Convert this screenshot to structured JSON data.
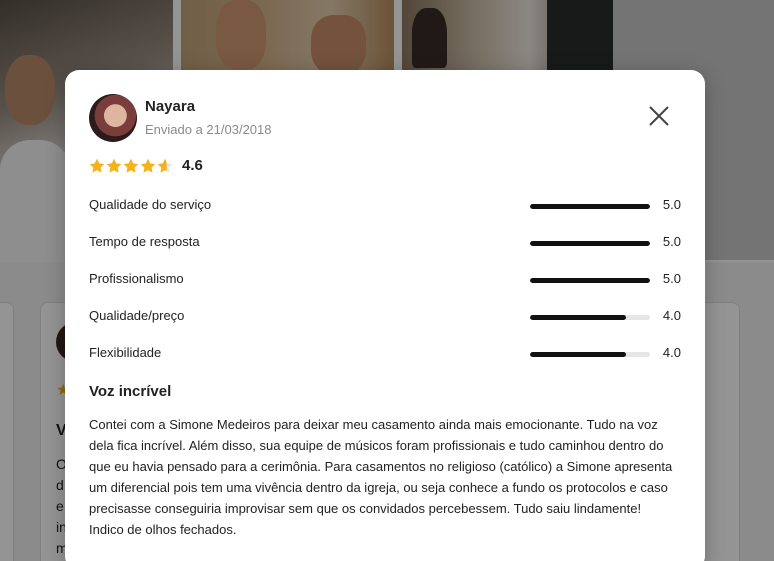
{
  "review": {
    "author": "Nayara",
    "date": "Enviado a 21/03/2018",
    "rating": 4.6,
    "rating_text": "4.6",
    "stars_filled": 4.6,
    "criteria": [
      {
        "label": "Qualidade do serviço",
        "value": "5.0",
        "score": 5.0
      },
      {
        "label": "Tempo de resposta",
        "value": "5.0",
        "score": 5.0
      },
      {
        "label": "Profissionalismo",
        "value": "5.0",
        "score": 5.0
      },
      {
        "label": "Qualidade/preço",
        "value": "4.0",
        "score": 4.0
      },
      {
        "label": "Flexibilidade",
        "value": "4.0",
        "score": 4.0
      }
    ],
    "title": "Voz incrível",
    "body": "Contei com a Simone Medeiros para deixar meu casamento ainda mais emocionante. Tudo na voz dela fica incrível. Além disso, sua equipe de músicos foram profissionais e tudo caminhou dentro do que eu havia pensado para a cerimônia. Para casamentos no religioso (católico) a Simone apresenta um diferencial pois tem uma vivência dentro da igreja, ou seja conhece a fundo os protocolos e caso precisasse conseguiria improvisar sem que os convidados percebessem. Tudo saiu lindamente! Indico de olhos fechados."
  },
  "background_card": {
    "letters": [
      "V",
      "O",
      "d",
      "e",
      "in",
      "m"
    ]
  },
  "icons": {
    "close": "close-icon",
    "star": "star-icon"
  },
  "colors": {
    "star": "#f5b31b",
    "bar_fill": "#111111",
    "bar_track": "#e6e6e6"
  }
}
